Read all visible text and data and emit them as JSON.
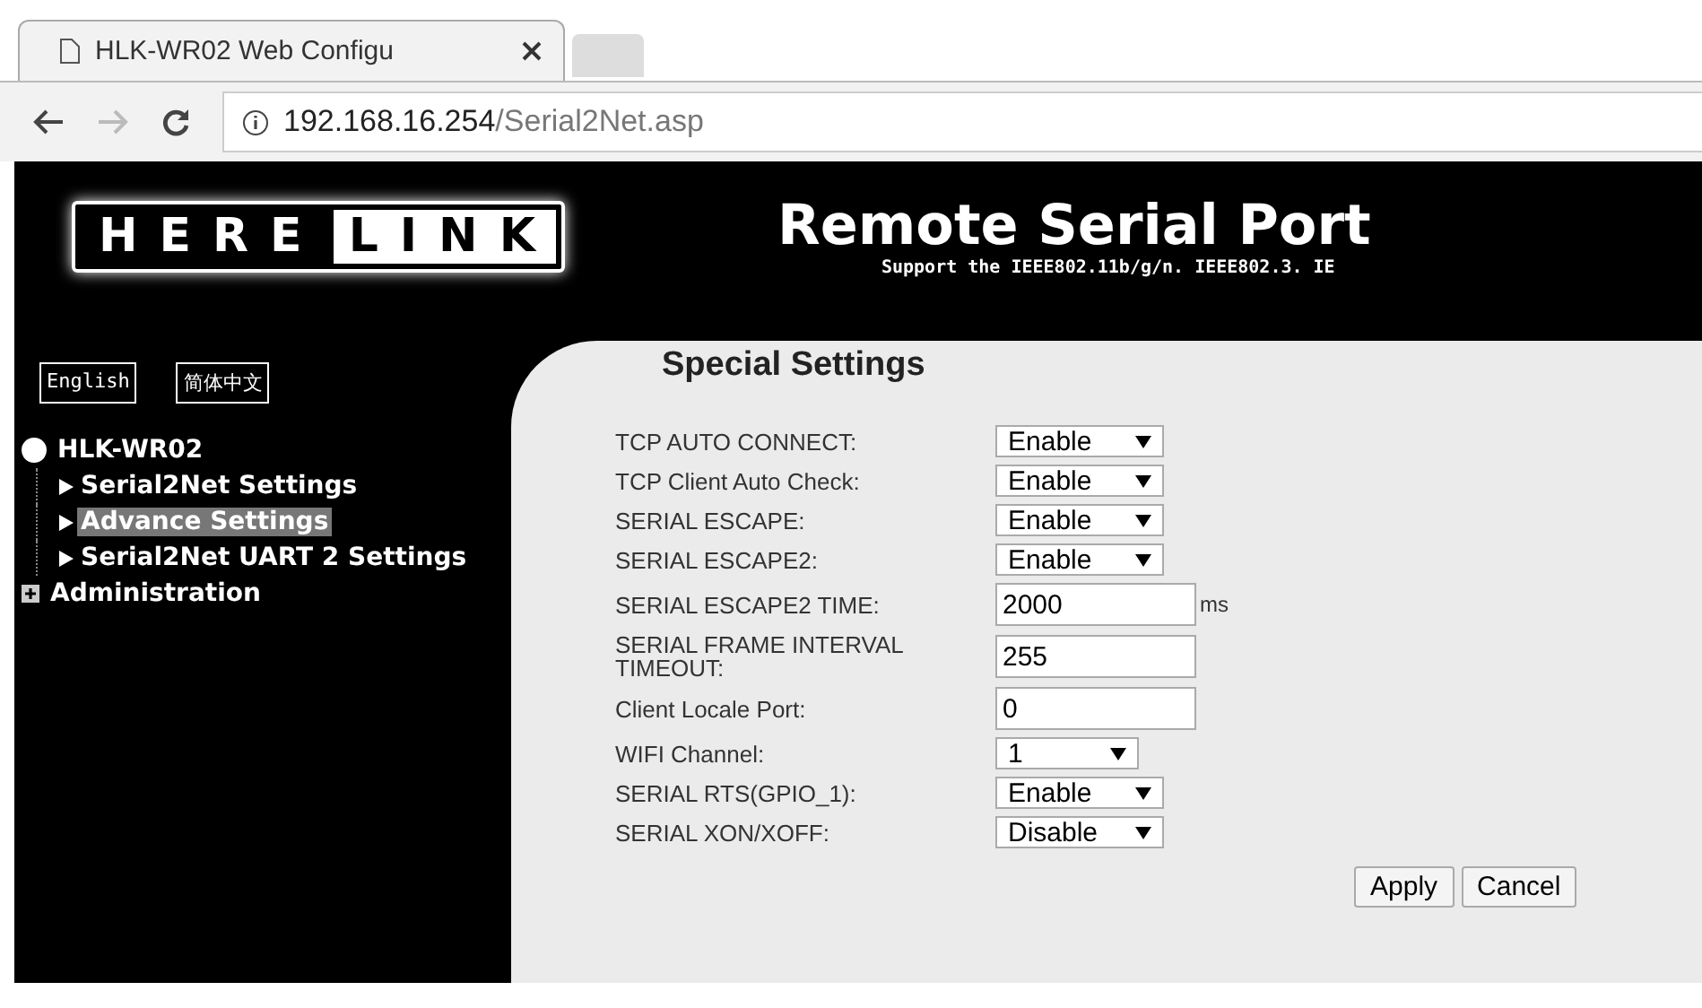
{
  "browser": {
    "tab_title": "HLK-WR02 Web Configu",
    "url_host": "192.168.16.254",
    "url_path": "/Serial2Net.asp"
  },
  "header": {
    "logo_left": "HERE",
    "logo_right": "LINK",
    "title": "Remote Serial Port",
    "subtitle": "Support the IEEE802.11b/g/n. IEEE802.3. IE"
  },
  "languages": [
    "English",
    "简体中文"
  ],
  "tree": [
    {
      "label": "HLK-WR02",
      "expanded": true,
      "children": [
        {
          "label": "Serial2Net Settings",
          "selected": false
        },
        {
          "label": "Advance Settings",
          "selected": true
        },
        {
          "label": "Serial2Net UART 2 Settings",
          "selected": false
        }
      ]
    },
    {
      "label": "Administration",
      "expanded": false
    }
  ],
  "panel": {
    "title": "Special Settings",
    "fields": [
      {
        "kind": "select",
        "label": "TCP AUTO CONNECT:",
        "value": "Enable"
      },
      {
        "kind": "select",
        "label": "TCP Client Auto Check:",
        "value": "Enable"
      },
      {
        "kind": "select",
        "label": "SERIAL ESCAPE:",
        "value": "Enable"
      },
      {
        "kind": "select",
        "label": "SERIAL ESCAPE2:",
        "value": "Enable"
      },
      {
        "kind": "input",
        "label": "SERIAL ESCAPE2 TIME:",
        "value": "2000",
        "unit": "ms"
      },
      {
        "kind": "input",
        "label": "SERIAL FRAME INTERVAL TIMEOUT:",
        "value": "255"
      },
      {
        "kind": "input",
        "label": "Client Locale Port:",
        "value": "0"
      },
      {
        "kind": "select",
        "label": "WIFI Channel:",
        "value": "1"
      },
      {
        "kind": "select",
        "label": "SERIAL RTS(GPIO_1):",
        "value": "Enable"
      },
      {
        "kind": "select",
        "label": "SERIAL XON/XOFF:",
        "value": "Disable"
      }
    ],
    "buttons": [
      "Apply",
      "Cancel"
    ]
  }
}
